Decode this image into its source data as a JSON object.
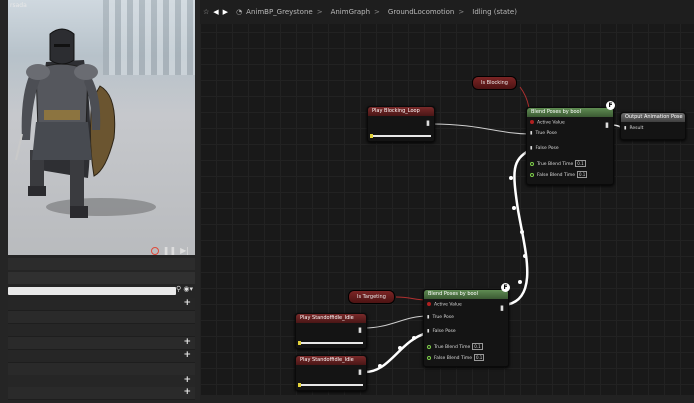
{
  "viewport": {
    "label": "rsada"
  },
  "breadcrumb": {
    "items": [
      "AnimBP_Greystone",
      "AnimGraph",
      "GroundLocomotion",
      "Idling (state)"
    ]
  },
  "nodes": {
    "blend1": {
      "title": "Blend Poses by bool",
      "pins": [
        "Active Value",
        "True Pose",
        "False Pose",
        "True Blend Time",
        "False Blend Time"
      ],
      "true_blend_time": "0.1",
      "false_blend_time": "0.1"
    },
    "blend2": {
      "title": "Blend Poses by bool",
      "pins": [
        "Active Value",
        "True Pose",
        "False Pose",
        "True Blend Time",
        "False Blend Time"
      ],
      "true_blend_time": "0.1",
      "false_blend_time": "0.1"
    },
    "output_pose": {
      "title": "Output Animation Pose",
      "pin": "Result"
    },
    "is_blocking": {
      "label": "Is Blocking"
    },
    "is_targeting": {
      "label": "Is Targeting"
    },
    "play_blocking_loop": {
      "title": "Play Blocking_Loop"
    },
    "play_standoff_idle_1": {
      "title": "Play Standoffidle_Idle"
    },
    "play_standoff_idle_2": {
      "title": "Play Standoffidle_Idle"
    }
  },
  "colors": {
    "accent_green": "#5f8c52",
    "bool_red": "#7a2a2a",
    "exec_white": "#ffffff"
  }
}
